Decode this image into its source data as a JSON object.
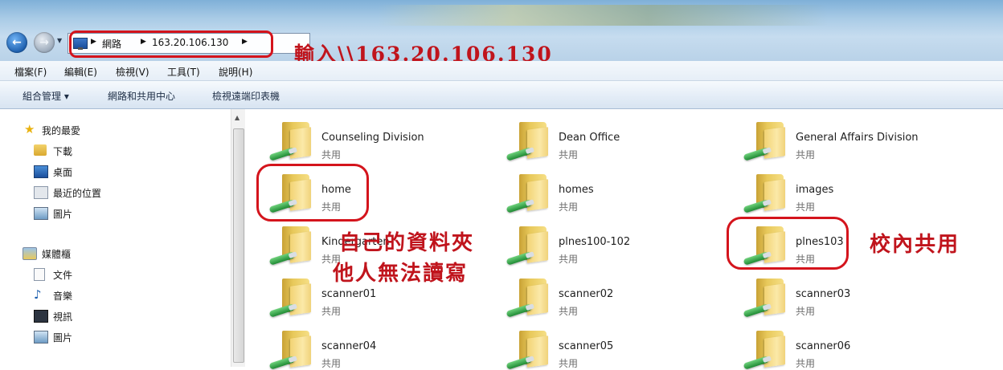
{
  "address_bar": {
    "location_icon": "network-icon",
    "crumbs": [
      "網路",
      "163.20.106.130"
    ]
  },
  "menu": [
    "檔案(F)",
    "編輯(E)",
    "檢視(V)",
    "工具(T)",
    "說明(H)"
  ],
  "command_bar": {
    "organize": "組合管理 ▾",
    "network_center": "網路和共用中心",
    "printers": "檢視遠端印表機"
  },
  "nav_pane": {
    "favorites": {
      "label": "我的最愛",
      "icon": "star-icon",
      "items": [
        "下載",
        "桌面",
        "最近的位置",
        "圖片"
      ]
    },
    "libraries": {
      "label": "媒體櫃",
      "icon": "library-icon",
      "items": [
        "文件",
        "音樂",
        "視訊",
        "圖片"
      ]
    }
  },
  "shares": [
    {
      "name": "Counseling Division",
      "type": "共用"
    },
    {
      "name": "Dean Office",
      "type": "共用"
    },
    {
      "name": "General Affairs Division",
      "type": "共用"
    },
    {
      "name": "home",
      "type": "共用"
    },
    {
      "name": "homes",
      "type": "共用"
    },
    {
      "name": "images",
      "type": "共用"
    },
    {
      "name": "Kindergarten",
      "type": "共用"
    },
    {
      "name": "plnes100-102",
      "type": "共用"
    },
    {
      "name": "plnes103",
      "type": "共用"
    },
    {
      "name": "scanner01",
      "type": "共用"
    },
    {
      "name": "scanner02",
      "type": "共用"
    },
    {
      "name": "scanner03",
      "type": "共用"
    },
    {
      "name": "scanner04",
      "type": "共用"
    },
    {
      "name": "scanner05",
      "type": "共用"
    },
    {
      "name": "scanner06",
      "type": "共用"
    }
  ],
  "annotations": {
    "address": "輸入\\\\163.20.106.130",
    "home_line1": "自己的資料夾",
    "home_line2": "他人無法讀寫",
    "plnes103": "校內共用"
  },
  "colors": {
    "annotation": "#d4141c",
    "title_bar": "#a9cbe6"
  }
}
